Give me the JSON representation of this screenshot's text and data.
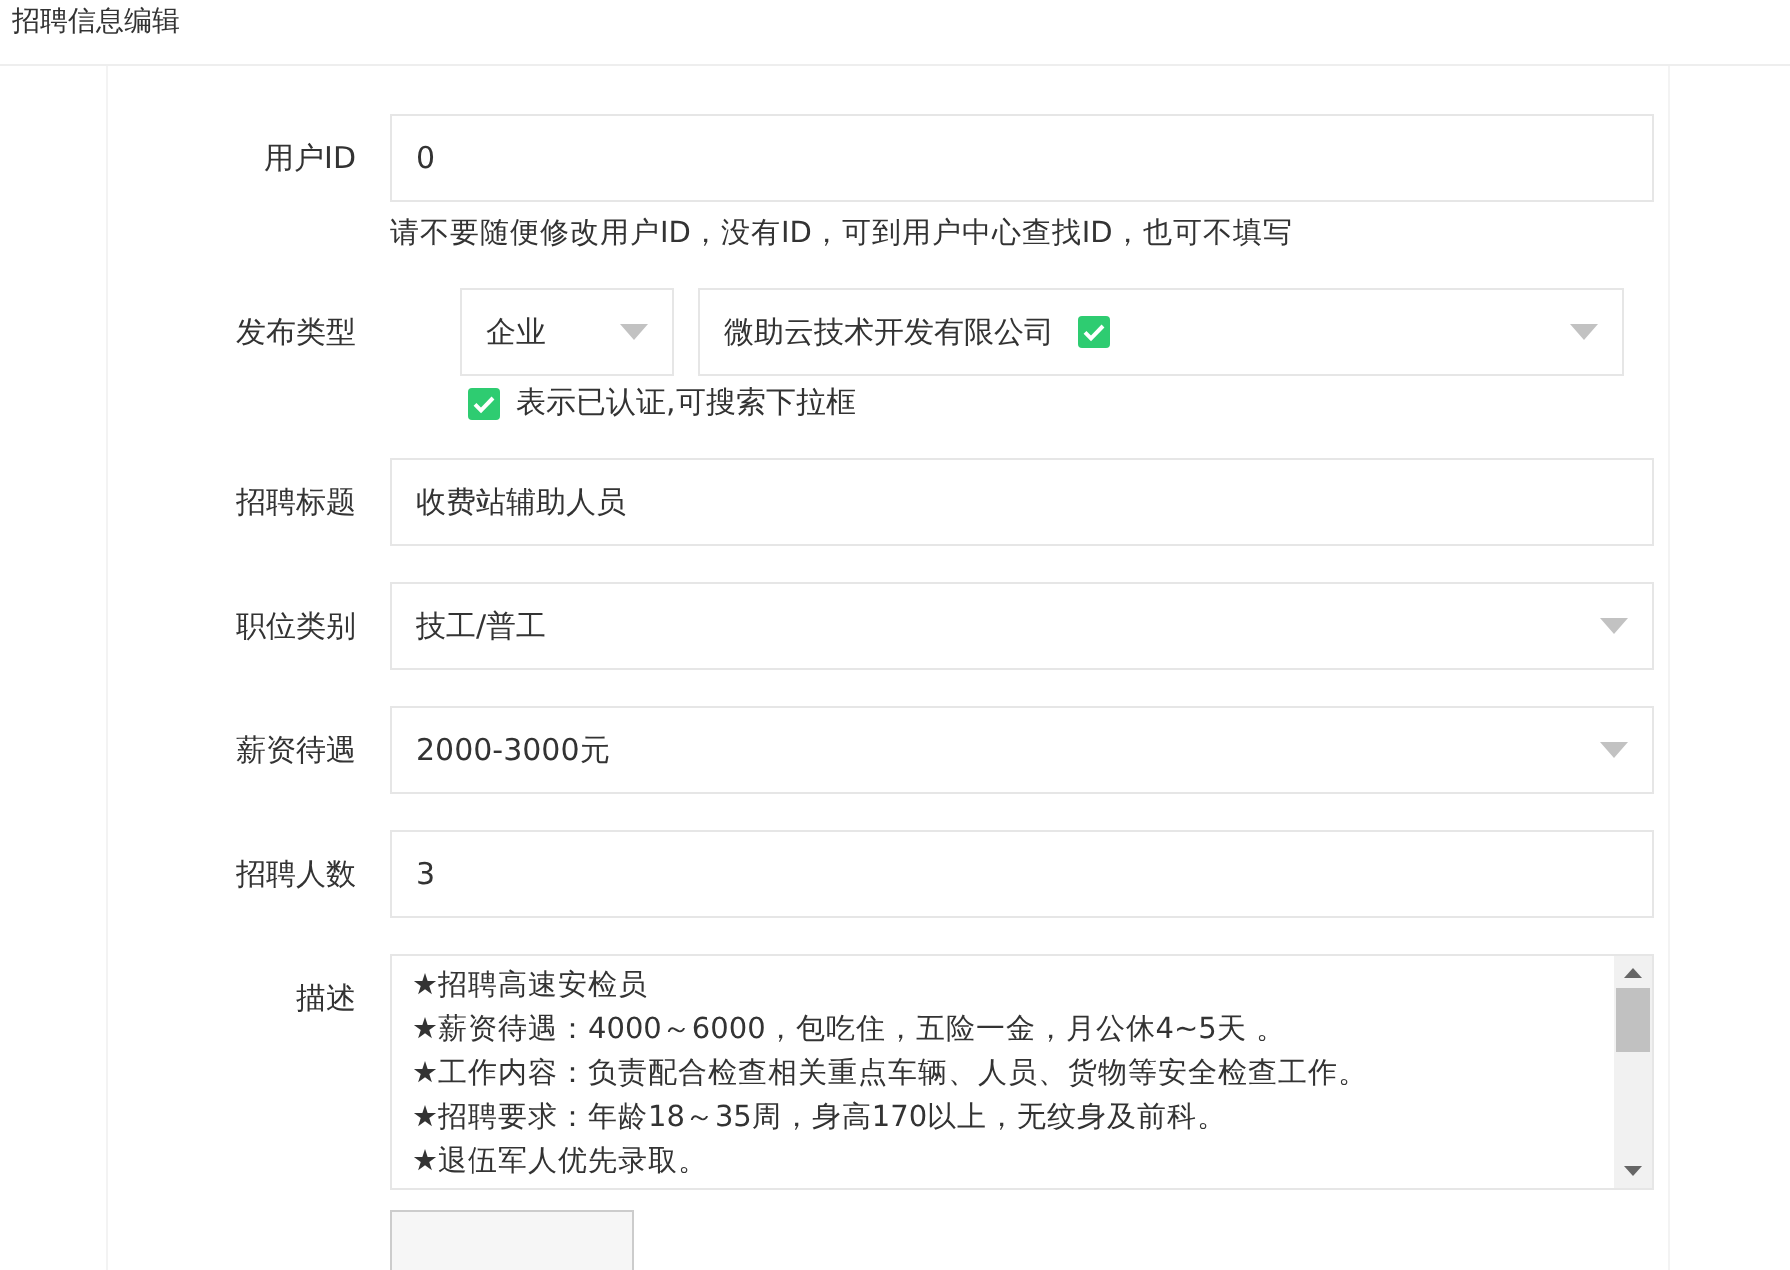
{
  "window": {
    "title": "招聘信息编辑"
  },
  "form": {
    "user_id": {
      "label": "用户ID",
      "value": "0",
      "hint": "请不要随便修改用户ID，没有ID，可到用户中心查找ID，也可不填写"
    },
    "publish_type": {
      "label": "发布类型",
      "type_value": "企业",
      "company": "微助云技术开发有限公司",
      "verified": true,
      "legend": "表示已认证,可搜索下拉框"
    },
    "fields": [
      {
        "kind": "input",
        "label": "招聘标题",
        "value": "收费站辅助人员"
      },
      {
        "kind": "select",
        "label": "职位类别",
        "value": "技工/普工"
      },
      {
        "kind": "select",
        "label": "薪资待遇",
        "value": "2000-3000元"
      },
      {
        "kind": "input",
        "label": "招聘人数",
        "value": "3"
      }
    ],
    "description": {
      "label": "描述",
      "lines": [
        "★招聘高速安检员",
        "★薪资待遇：4000～6000，包吃住，五险一金，月公休4~5天 。",
        "★工作内容：负责配合检查相关重点车辆、人员、货物等安全检查工作。",
        "★招聘要求：年龄18～35周，身高170以上，无纹身及前科。",
        "★退伍军人优先录取。"
      ]
    }
  }
}
